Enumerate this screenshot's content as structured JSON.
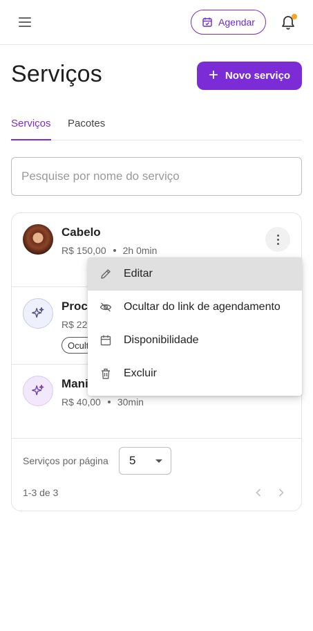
{
  "topbar": {
    "menu_icon": "hamburger-icon",
    "agendar_label": "Agendar",
    "agendar_icon": "calendar-icon",
    "bell_icon": "bell-icon",
    "notification_color": "#f5a623"
  },
  "header": {
    "title": "Serviços",
    "new_button_label": "Novo serviço",
    "accent_color": "#7b2cd6"
  },
  "tabs": [
    {
      "label": "Serviços",
      "active": true
    },
    {
      "label": "Pacotes",
      "active": false
    }
  ],
  "search": {
    "placeholder": "Pesquise por nome do serviço",
    "value": ""
  },
  "services": [
    {
      "name": "Cabelo",
      "price": "R$ 150,00",
      "duration": "2h 0min",
      "avatar": "photo-avatar"
    },
    {
      "name": "Proce",
      "price": "R$ 22",
      "duration": "",
      "chip": "Ocult",
      "avatar": "sparkles-icon"
    },
    {
      "name": "Mani",
      "price": "R$ 40,00",
      "duration": "30min",
      "avatar": "sparkles-icon"
    }
  ],
  "menu": {
    "items": [
      {
        "label": "Editar",
        "icon": "pencil-icon",
        "highlighted": true
      },
      {
        "label": "Ocultar do link de agendamento",
        "icon": "eye-off-icon",
        "highlighted": false
      },
      {
        "label": "Disponibilidade",
        "icon": "calendar-icon",
        "highlighted": false
      },
      {
        "label": "Excluir",
        "icon": "trash-icon",
        "highlighted": false
      }
    ]
  },
  "pagination": {
    "per_page_label": "Serviços por página",
    "per_page_value": "5",
    "range_text": "1-3 de 3"
  }
}
